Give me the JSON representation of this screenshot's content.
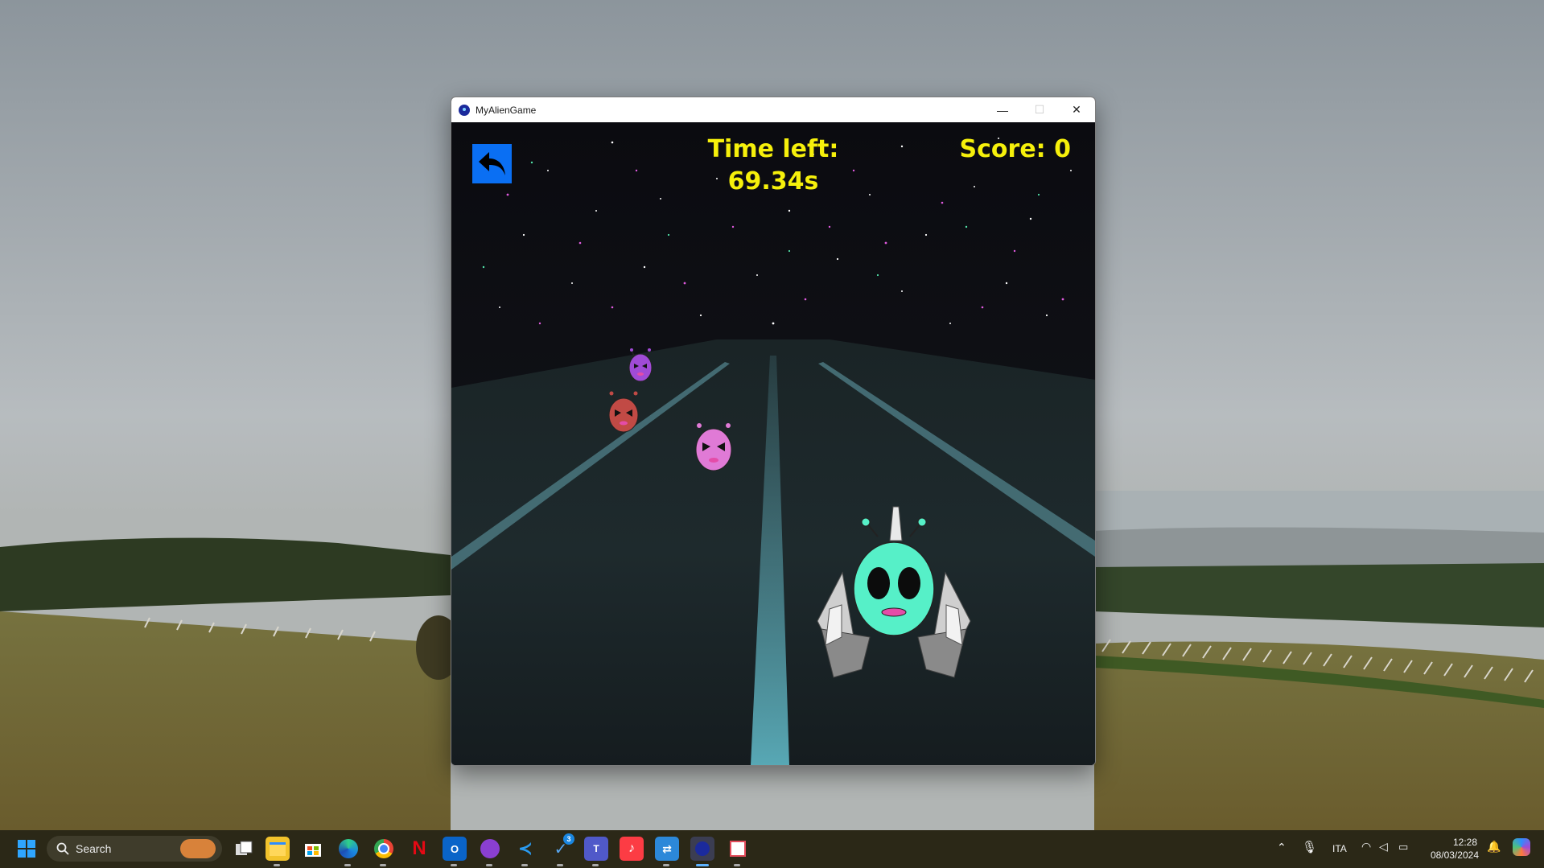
{
  "window": {
    "title": "MyAlienGame",
    "minimize_glyph": "—",
    "maximize_glyph": "☐",
    "close_glyph": "✕"
  },
  "game": {
    "time_label": "Time left:",
    "time_value": "69.34s",
    "score_label": "Score: 0",
    "back_button": "back-arrow-icon",
    "player": {
      "color": "#56f0c8",
      "role": "player-alien-spaceship"
    },
    "enemies": [
      {
        "color": "#a04bd6",
        "name": "purple-alien"
      },
      {
        "color": "#c14a45",
        "name": "red-alien"
      },
      {
        "color": "#e07ad6",
        "name": "pink-alien"
      }
    ]
  },
  "taskbar": {
    "search_placeholder": "Search",
    "apps": [
      "start-button",
      "task-view",
      "file-explorer",
      "microsoft-store",
      "edge",
      "chrome",
      "netflix",
      "outlook",
      "github-desktop",
      "vscode",
      "steam",
      "teams",
      "apple-music",
      "remote-desktop",
      "my-alien-game",
      "snipping-tool"
    ],
    "steam_badge": "3",
    "language": "ITA",
    "time": "12:28",
    "date": "08/03/2024"
  },
  "colors": {
    "hud_yellow": "#f6f00b",
    "back_button_blue": "#0a6ff3",
    "taskbar_bg": "#2b2817"
  }
}
